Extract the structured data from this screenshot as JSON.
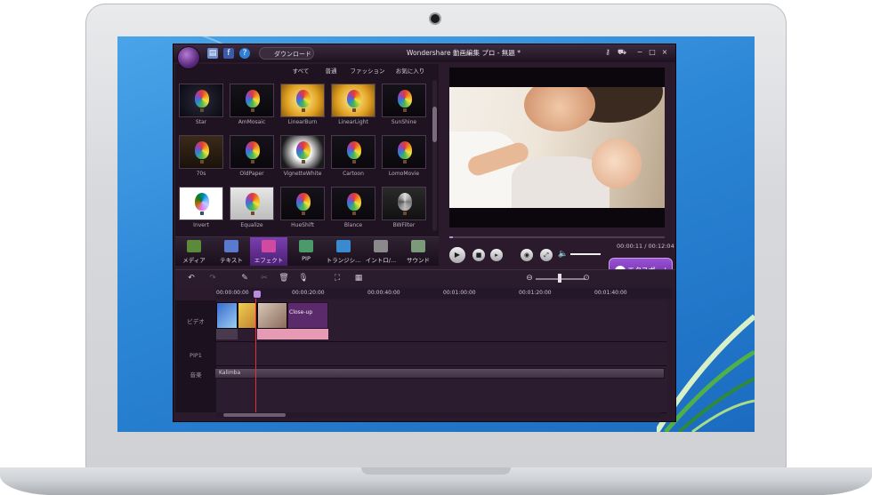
{
  "app": {
    "title": "Wondershare 動画編集 プロ - 無題 *",
    "download_label": "ダウンロード",
    "window_controls": [
      "−",
      "□",
      "×"
    ]
  },
  "filter_tabs": [
    {
      "label": "すべて",
      "active": true
    },
    {
      "label": "普通",
      "active": false
    },
    {
      "label": "ファッション",
      "active": false
    },
    {
      "label": "お気に入り",
      "active": false
    }
  ],
  "effects": [
    {
      "name": "Star",
      "style": "star"
    },
    {
      "name": "AmMosaic",
      "style": "plain"
    },
    {
      "name": "LinearBurn",
      "style": "gold"
    },
    {
      "name": "LinearLight",
      "style": "gold"
    },
    {
      "name": "SunShine",
      "style": "plain"
    },
    {
      "name": "70s",
      "style": "warm"
    },
    {
      "name": "OldPaper",
      "style": "plain"
    },
    {
      "name": "VignetteWhite",
      "style": "vignette"
    },
    {
      "name": "Cartoon",
      "style": "plain"
    },
    {
      "name": "LomoMovie",
      "style": "plain"
    },
    {
      "name": "Invert",
      "style": "invert"
    },
    {
      "name": "Equalize",
      "style": "light"
    },
    {
      "name": "HueShift",
      "style": "plain"
    },
    {
      "name": "Blance",
      "style": "plain"
    },
    {
      "name": "BWFilter",
      "style": "gray"
    }
  ],
  "categories": [
    {
      "label": "メディア",
      "active": false,
      "icon": "media-icon",
      "color": "#5a8a3a"
    },
    {
      "label": "テキスト",
      "active": false,
      "icon": "text-icon",
      "color": "#5a7ad0"
    },
    {
      "label": "エフェクト",
      "active": true,
      "icon": "effect-icon",
      "color": "#d04aa0"
    },
    {
      "label": "PIP",
      "active": false,
      "icon": "pip-icon",
      "color": "#4a9a6a"
    },
    {
      "label": "トランジシ...",
      "active": false,
      "icon": "transition-icon",
      "color": "#3a8ad0"
    },
    {
      "label": "イントロ/...",
      "active": false,
      "icon": "intro-icon",
      "color": "#8a8a8a"
    },
    {
      "label": "サウンド",
      "active": false,
      "icon": "sound-icon",
      "color": "#7a9a7a"
    }
  ],
  "player": {
    "time": "00:00:11 / 00:12:04",
    "progress": 0.015,
    "volume": 0.8
  },
  "export_label": "エクスポート",
  "ruler_labels": [
    "00:00:00:00",
    "00:00:20:00",
    "00:00:40:00",
    "00:01:00:00",
    "00:01:20:00",
    "00:01:40:00"
  ],
  "tracks": {
    "video_label": "ビデオ",
    "pip_label": "PIP1",
    "music_label": "音楽",
    "clip_title": "Close-up",
    "audio_clip": "Kalimba"
  },
  "colors": {
    "accent": "#7b3fb0",
    "playhead": "#e23333",
    "clip_pink": "#e69ab4"
  }
}
